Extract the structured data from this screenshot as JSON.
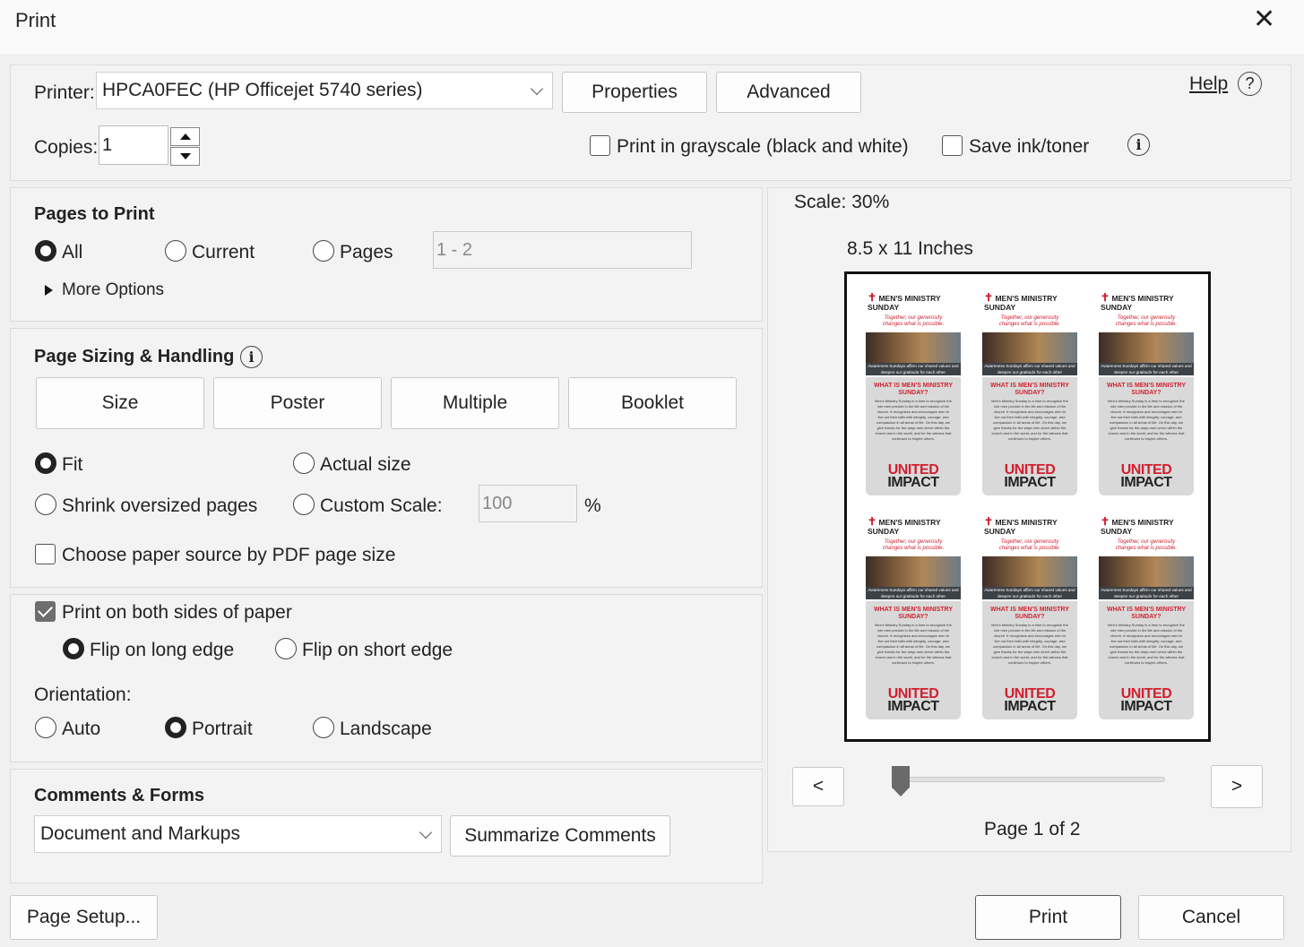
{
  "window": {
    "title": "Print",
    "close_glyph": "✕"
  },
  "header": {
    "printer_label": "Printer:",
    "printer_value": "HPCA0FEC (HP Officejet 5740 series)",
    "properties_label": "Properties",
    "advanced_label": "Advanced",
    "help_label": "Help",
    "copies_label": "Copies:",
    "copies_value": "1",
    "grayscale_label": "Print in grayscale (black and white)",
    "grayscale_checked": false,
    "saveink_label": "Save ink/toner",
    "saveink_checked": false
  },
  "pages_to_print": {
    "heading": "Pages to Print",
    "options": [
      "All",
      "Current",
      "Pages"
    ],
    "selected": "All",
    "pages_value": "1 - 2",
    "more_options_label": "More Options"
  },
  "sizing": {
    "heading": "Page Sizing & Handling",
    "tabs": [
      "Size",
      "Poster",
      "Multiple",
      "Booklet"
    ],
    "fit_label": "Fit",
    "actual_label": "Actual size",
    "shrink_label": "Shrink oversized pages",
    "custom_label": "Custom Scale:",
    "custom_value": "100",
    "percent": "%",
    "selected": "Fit",
    "paper_source_label": "Choose paper source by PDF page size",
    "paper_source_checked": false
  },
  "duplex": {
    "both_sides_label": "Print on both sides of paper",
    "both_sides_checked": true,
    "long_edge_label": "Flip on long edge",
    "short_edge_label": "Flip on short edge",
    "flip_selected": "Flip on long edge",
    "orientation_label": "Orientation:",
    "auto_label": "Auto",
    "portrait_label": "Portrait",
    "landscape_label": "Landscape",
    "orientation_selected": "Portrait"
  },
  "comments": {
    "heading": "Comments & Forms",
    "select_value": "Document and Markups",
    "summarize_label": "Summarize Comments"
  },
  "preview": {
    "scale_label": "Scale:",
    "scale_value": "30%",
    "paper_size": "8.5 x 11 Inches",
    "page_indicator": "Page 1 of 2",
    "page_position": 0.0,
    "prev_glyph": "<",
    "next_glyph": ">",
    "card": {
      "title_line1": "MEN'S MINISTRY",
      "title_line2": "SUNDAY",
      "tagline": "Together, our generosity changes what is possible.",
      "band": "Awareness Sundays affirm our shared values and deepen our gratitude for each other",
      "question": "WHAT IS MEN'S MINISTRY SUNDAY?",
      "body": "Men's Ministry Sunday is a time to recognize the role men provide in the life and mission of the church. It recognizes and encourages men to live out their faith with integrity, courage, and compassion in all areas of life. On this day, we give thanks for the ways men serve within the church and in the world, and for the witness that continues to inspire others.",
      "logo_line1": "UNITED",
      "logo_line2": "IMPACT"
    }
  },
  "footer": {
    "page_setup_label": "Page Setup...",
    "print_label": "Print",
    "cancel_label": "Cancel"
  },
  "colors": {
    "accent_red": "#d0202f",
    "checkbox_fill": "#6e6e6e",
    "background": "#f0f0f0"
  }
}
